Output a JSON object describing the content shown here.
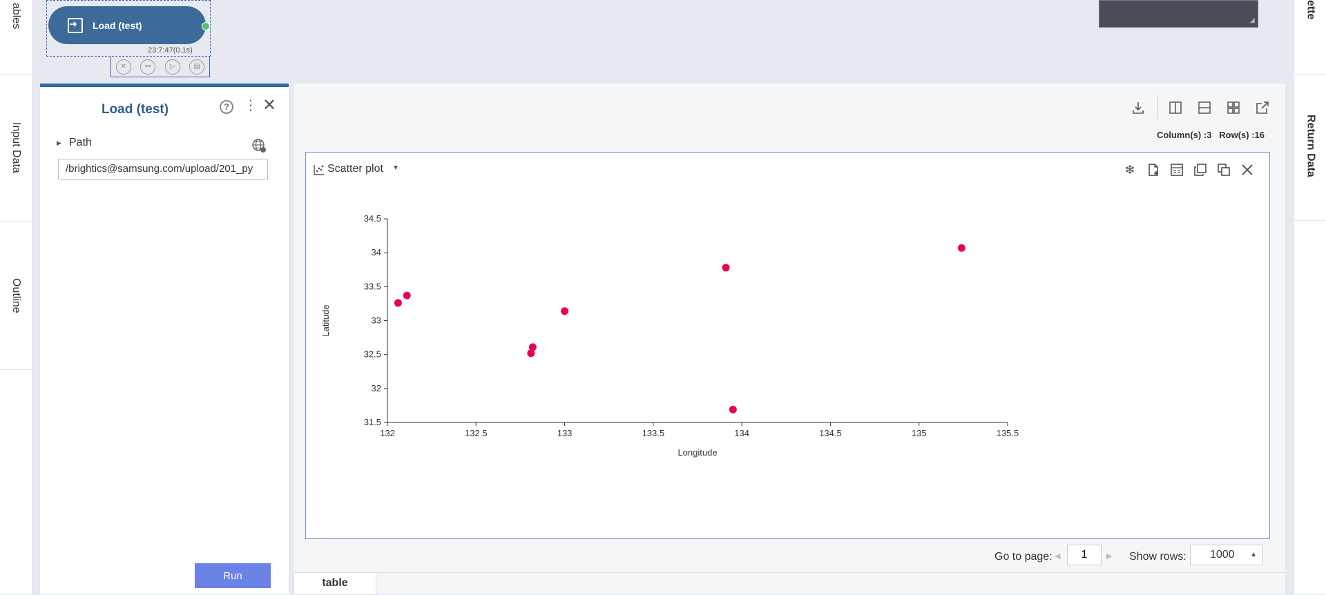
{
  "left_tabs": [
    {
      "label": "ables"
    },
    {
      "label": "Input Data"
    },
    {
      "label": "Outline"
    }
  ],
  "right_tabs": [
    {
      "label": "ette"
    },
    {
      "label": "Return Data"
    }
  ],
  "node": {
    "label": "Load (test)",
    "timestamp": "23:7:47(0.1s)"
  },
  "property_panel": {
    "title": "Load (test)",
    "help_glyph": "?",
    "path_label": "Path",
    "path_value": "/brightics@samsung.com/upload/201_py",
    "run_label": "Run"
  },
  "result": {
    "columns_text": "Column(s) :3",
    "rows_text": "Row(s) :16",
    "chart_type_label": "Scatter plot",
    "goto_label": "Go to page:",
    "page_value": "1",
    "show_rows_label": "Show rows:",
    "show_rows_value": "1000",
    "tab_label": "table"
  },
  "colors": {
    "accent": "#2f6a9f",
    "node": "#3d6b99",
    "run_button": "#6b82e6",
    "point": "#e8005c"
  },
  "chart_data": {
    "type": "scatter",
    "xlabel": "Longitude",
    "ylabel": "Latitude",
    "xlim": [
      132,
      135.5
    ],
    "ylim": [
      31.5,
      34.5
    ],
    "xticks": [
      "132",
      "132.5",
      "133",
      "133.5",
      "134",
      "134.5",
      "135",
      "135.5"
    ],
    "yticks": [
      "31.5",
      "32",
      "32.5",
      "33",
      "33.5",
      "34",
      "34.5"
    ],
    "points": [
      {
        "x": 132.06,
        "y": 33.26
      },
      {
        "x": 132.11,
        "y": 33.37
      },
      {
        "x": 132.81,
        "y": 32.52
      },
      {
        "x": 132.82,
        "y": 32.61
      },
      {
        "x": 133.0,
        "y": 33.14
      },
      {
        "x": 133.91,
        "y": 33.78
      },
      {
        "x": 133.95,
        "y": 31.69
      },
      {
        "x": 135.24,
        "y": 34.07
      }
    ]
  }
}
